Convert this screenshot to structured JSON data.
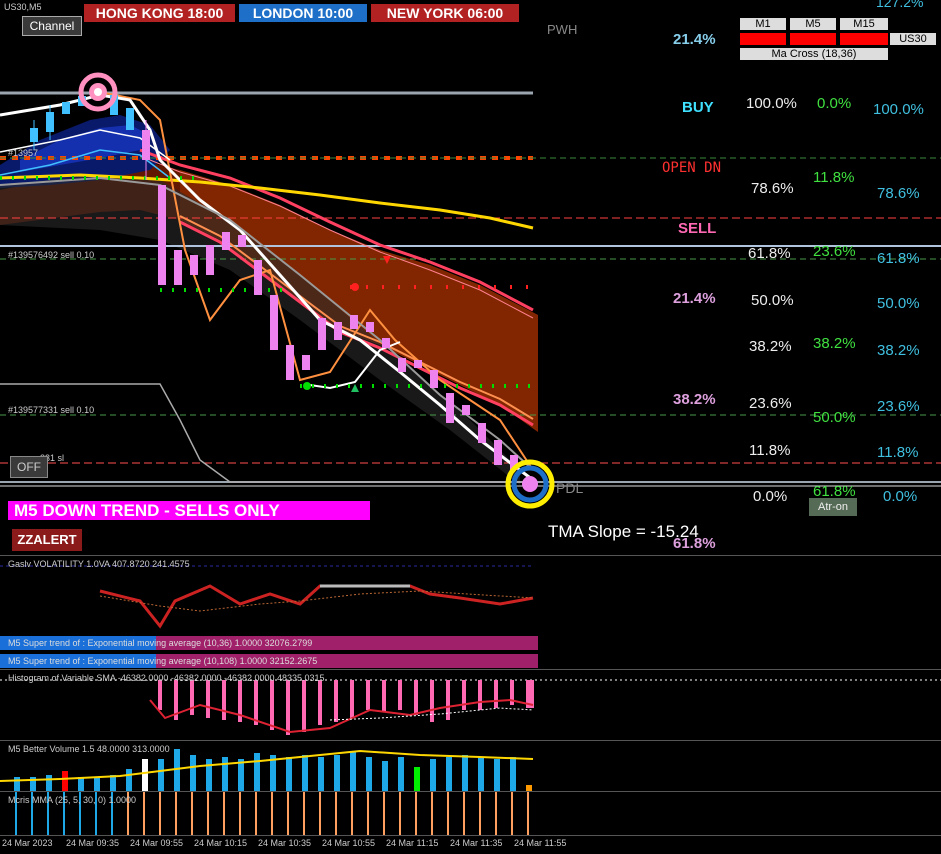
{
  "symbol": "US30,M5",
  "buttons": {
    "channel": "Channel",
    "off": "OFF",
    "atr": "Atr-on",
    "zzalert": "ZZALERT"
  },
  "sessions": [
    {
      "label": "HONG KONG 18:00",
      "color": "#b22222"
    },
    {
      "label": "LONDON   10:00",
      "color": "#1e6fc8"
    },
    {
      "label": "NEW YORK 06:00",
      "color": "#b22222"
    }
  ],
  "pwh": "PWH",
  "pdl": "PDL",
  "mtf": {
    "m1": "M1",
    "m5": "M5",
    "m15": "M15",
    "sym": "US30",
    "macross": "Ma Cross (18,36)"
  },
  "top_right_pct": "127.2%",
  "left_levels": [
    {
      "t": "21.4%",
      "c": "#87ceeb"
    },
    {
      "t": "BUY",
      "c": "#40e0ff"
    },
    {
      "t": "OPEN  DN",
      "c": "#ff3030"
    },
    {
      "t": "SELL",
      "c": "#ff69b4"
    },
    {
      "t": "21.4%",
      "c": "#dda0dd"
    },
    {
      "t": "38.2%",
      "c": "#dda0dd"
    },
    {
      "t": "61.8%",
      "c": "#dda0dd"
    }
  ],
  "fib_white": [
    "100.0%",
    "78.6%",
    "61.8%",
    "50.0%",
    "38.2%",
    "23.6%",
    "11.8%",
    "0.0%"
  ],
  "fib_green": [
    "0.0%",
    "11.8%",
    "23.6%",
    "38.2%",
    "50.0%",
    "61.8%"
  ],
  "fib_cyan": [
    "100.0%",
    "78.6%",
    "61.8%",
    "50.0%",
    "38.2%",
    "23.6%",
    "11.8%",
    "0.0%"
  ],
  "orders": {
    "sell1": "#139576492 sell 0.10",
    "sell2": "#139577331 sell 0.10",
    "sl": "331 sl",
    "prefix": "#13957"
  },
  "trend_banner": "M5  DOWN TREND - SELLS ONLY",
  "tma_slope": "TMA Slope = -15.24",
  "sub1_label": "Gaslv  VOLATILITY 1.0VA 407.8720 241.4575",
  "supertrend1": "M5   Super trend of : Exponential moving average (10,36)   1.0000  32076.2799",
  "supertrend2": "M5   Super trend of : Exponential moving average (10,108)  1.0000  32152.2675",
  "sub3_label": "Histogram of Variable SMA   -46382.0000  -46382.0000  -46382.0000  48335.0315",
  "volume_label": "M5 Better Volume 1.5 48.0000 313.0000",
  "mma_label": "Mcris MMA (25, 5, 30, 0) 1.0000",
  "time_axis": [
    "24 Mar 2023",
    "24 Mar 09:35",
    "24 Mar 09:55",
    "24 Mar 10:15",
    "24 Mar 10:35",
    "24 Mar 10:55",
    "24 Mar 11:15",
    "24 Mar 11:35",
    "24 Mar 11:55"
  ],
  "colors": {
    "bull": "#40c0ff",
    "bear": "#ee82ee",
    "bg": "#000000",
    "banner": "#ff00ff",
    "up_vol": "#1fa8e8",
    "climax": "#ff0000",
    "green_vol": "#00ee00"
  }
}
